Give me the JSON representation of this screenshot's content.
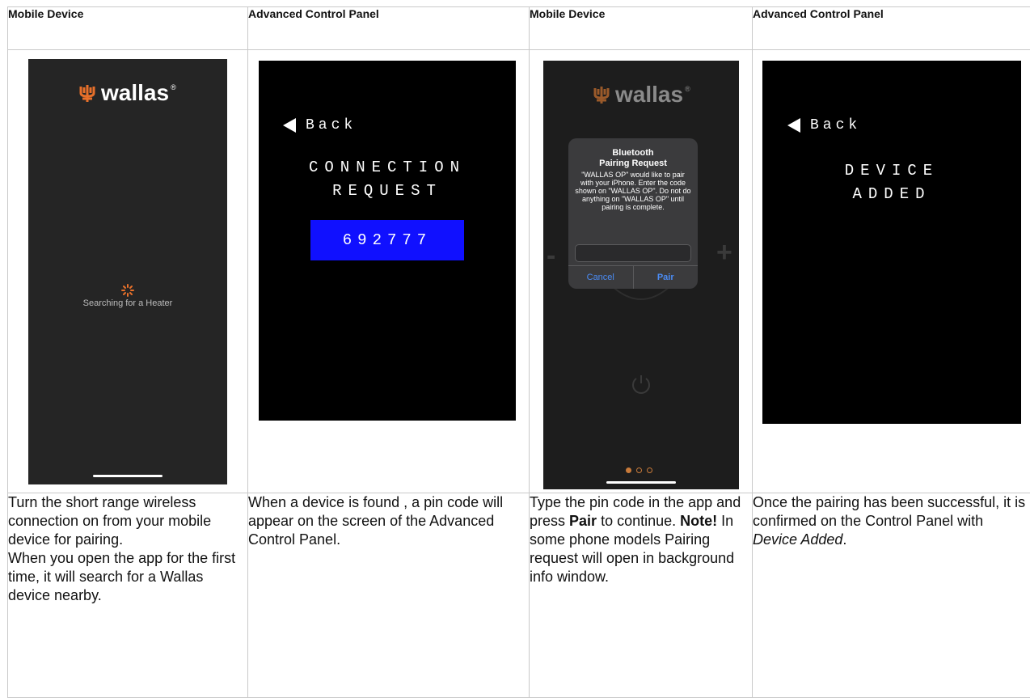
{
  "headers": [
    "Mobile Device",
    "Advanced Control Panel",
    "Mobile Device",
    "Advanced Control Panel"
  ],
  "phone1": {
    "logo_text": "wallas",
    "logo_reg": "®",
    "status_text": "Searching for a Heater"
  },
  "panel1": {
    "back_label": "Back",
    "title_line1": "CONNECTION",
    "title_line2": "REQUEST",
    "pin": "692777"
  },
  "phone3": {
    "logo_text": "wallas",
    "logo_reg": "®",
    "dialog_title_line1": "Bluetooth",
    "dialog_title_line2": "Pairing Request",
    "dialog_message": "\"WALLAS OP\" would like to pair with your iPhone. Enter the code shown on \"WALLAS OP\". Do not do anything on \"WALLAS OP\" until pairing is complete.",
    "cancel_label": "Cancel",
    "pair_label": "Pair",
    "minus": "-",
    "plus": "+"
  },
  "panel2": {
    "back_label": "Back",
    "title_line1": "DEVICE",
    "title_line2": "ADDED"
  },
  "descriptions": {
    "col1_line1": "Turn the short range wireless connection on from your mobile device for pairing.",
    "col1_line2": "When you open the app for the first time, it will search for a Wallas device nearby.",
    "col2": "When a device is found , a pin code will appear on the screen of the Advanced Control Panel.",
    "col3_a": "Type the pin code in the app and press ",
    "col3_b": "Pair",
    "col3_c": " to continue. ",
    "col3_d": "Note!",
    "col3_e": " In some phone models Pairing request will open in background info window.",
    "col4_a": "Once the pairing has been successful, it is confirmed on the Control Panel with ",
    "col4_b": "Device Added",
    "col4_c": "."
  },
  "colors": {
    "accent_orange": "#e8702a",
    "pin_blue": "#1010ff",
    "ios_blue": "#4b8cf5"
  }
}
